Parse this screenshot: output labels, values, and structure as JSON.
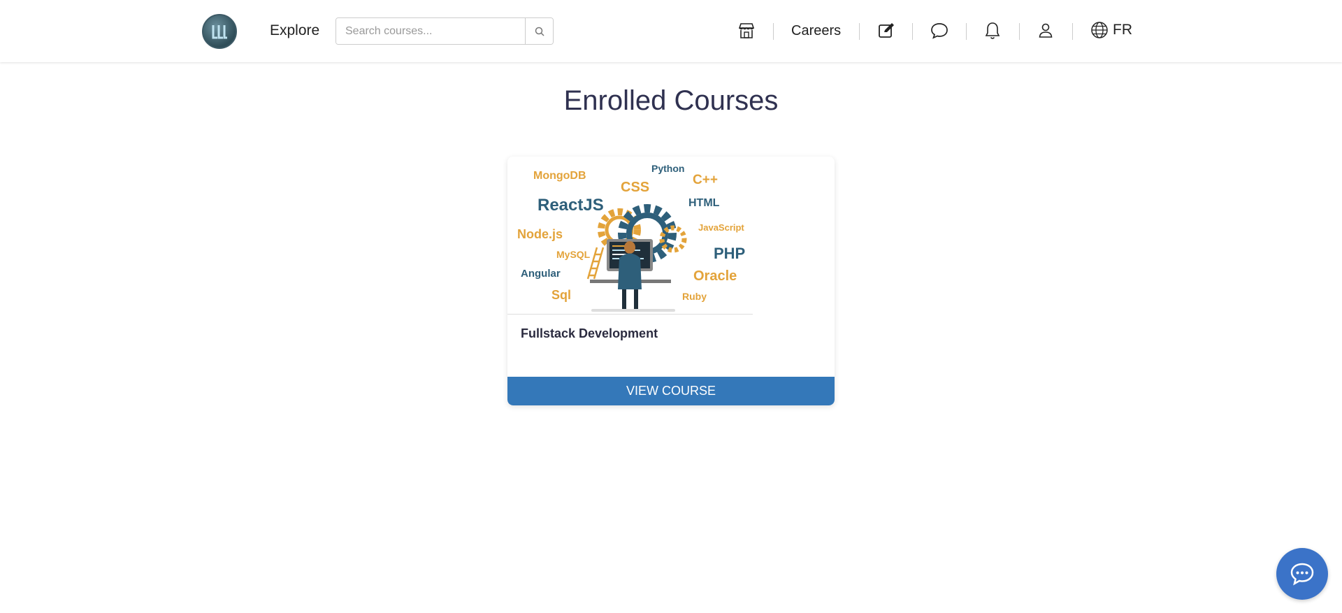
{
  "header": {
    "explore_label": "Explore",
    "search": {
      "placeholder": "Search courses...",
      "value": ""
    },
    "careers_label": "Careers",
    "language_label": "FR"
  },
  "main": {
    "title": "Enrolled Courses",
    "courses": [
      {
        "title": "Fullstack Development",
        "button_label": "VIEW COURSE",
        "thumbnail_tags": [
          "MongoDB",
          "Python",
          "C++",
          "CSS",
          "ReactJS",
          "HTML",
          "Node.js",
          "JavaScript",
          "MySQL",
          "PHP",
          "Angular",
          "Oracle",
          "Sql",
          "Ruby"
        ]
      }
    ]
  },
  "colors": {
    "accent": "#3478b9",
    "title": "#2f3150",
    "orange": "#e3a33a",
    "teal": "#2e5f7a",
    "chat": "#3b73c8"
  },
  "icons": [
    "logo",
    "search-icon",
    "store-icon",
    "edit-icon",
    "message-icon",
    "bell-icon",
    "user-icon",
    "globe-icon",
    "chat-bubble-icon"
  ]
}
